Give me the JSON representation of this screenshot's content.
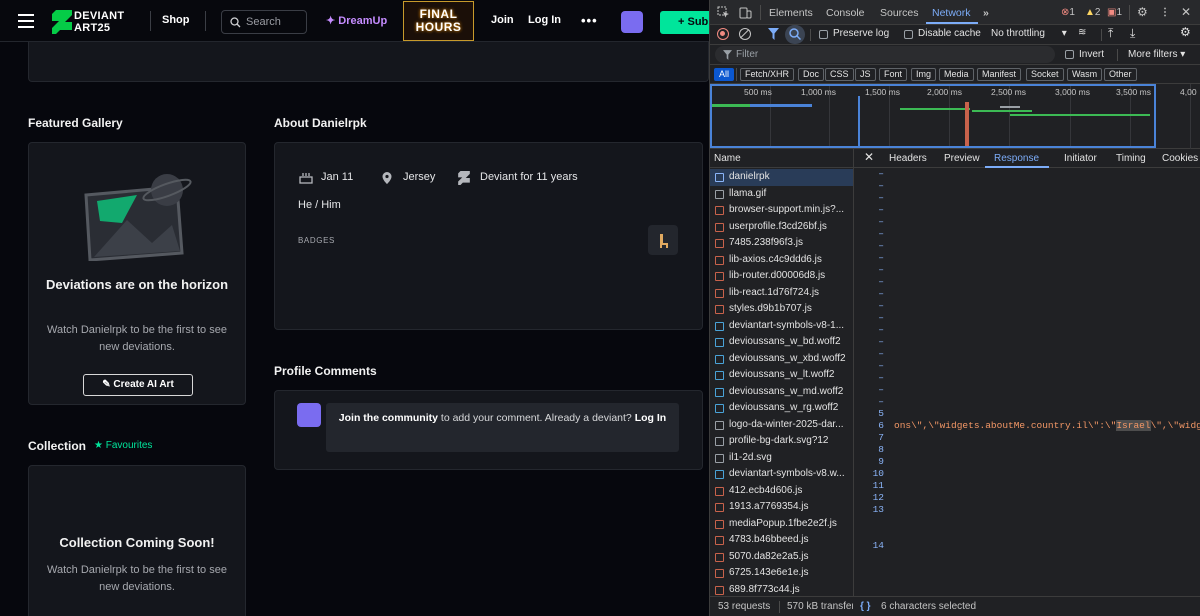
{
  "site": {
    "logo_line1": "DEVIANT",
    "logo_line2": "ART25",
    "nav": {
      "shop": "Shop",
      "search_placeholder": "Search",
      "dreamup": "DreamUp",
      "banner_line1": "FINAL",
      "banner_line2": "HOURS",
      "join": "Join",
      "login": "Log In",
      "more": "•••",
      "submit": "Sub"
    },
    "featured_gallery": {
      "title": "Featured Gallery",
      "empty_title": "Deviations are on the horizon",
      "empty_sub": "Watch Danielrpk to be the first to see new deviations.",
      "button": "Create AI Art"
    },
    "about": {
      "title": "About Danielrpk",
      "birthday": "Jan 11",
      "location": "Jersey",
      "deviant_for": "Deviant for 11 years",
      "pronouns": "He / Him",
      "badges_label": "BADGES"
    },
    "collection": {
      "title": "Collection",
      "favourites": "Favourites",
      "empty_title": "Collection Coming Soon!",
      "empty_sub": "Watch Danielrpk to be the first to see new deviations."
    },
    "comments": {
      "title": "Profile Comments",
      "join_link": "Join the community",
      "text": " to add your comment. Already a deviant? ",
      "login_link": "Log In"
    },
    "accent_color": "#00e59b"
  },
  "devtools": {
    "tabs": [
      "Elements",
      "Console",
      "Sources",
      "Network"
    ],
    "active_tab": "Network",
    "counts": {
      "errors": "1",
      "warnings": "2",
      "issues": "1"
    },
    "toolbar": {
      "preserve_log": "Preserve log",
      "disable_cache": "Disable cache",
      "throttling": "No throttling"
    },
    "filter": {
      "placeholder": "Filter",
      "invert": "Invert",
      "more_filters": "More filters"
    },
    "types": [
      "All",
      "Fetch/XHR",
      "Doc",
      "CSS",
      "JS",
      "Font",
      "Img",
      "Media",
      "Manifest",
      "Socket",
      "Wasm",
      "Other"
    ],
    "timeline_labels": [
      "500 ms",
      "1,000 ms",
      "1,500 ms",
      "2,000 ms",
      "2,500 ms",
      "3,000 ms",
      "3,500 ms",
      "4,00"
    ],
    "list_header": "Name",
    "requests": [
      {
        "name": "danielrpk",
        "kind": "doc"
      },
      {
        "name": "llama.gif",
        "kind": "img"
      },
      {
        "name": "browser-support.min.js?...",
        "kind": "js"
      },
      {
        "name": "userprofile.f3cd26bf.js",
        "kind": "js"
      },
      {
        "name": "7485.238f96f3.js",
        "kind": "js"
      },
      {
        "name": "lib-axios.c4c9ddd6.js",
        "kind": "js"
      },
      {
        "name": "lib-router.d00006d8.js",
        "kind": "js"
      },
      {
        "name": "lib-react.1d76f724.js",
        "kind": "js"
      },
      {
        "name": "styles.d9b1b707.js",
        "kind": "js"
      },
      {
        "name": "deviantart-symbols-v8-1...",
        "kind": "font"
      },
      {
        "name": "devioussans_w_bd.woff2",
        "kind": "font"
      },
      {
        "name": "devioussans_w_xbd.woff2",
        "kind": "font"
      },
      {
        "name": "devioussans_w_lt.woff2",
        "kind": "font"
      },
      {
        "name": "devioussans_w_md.woff2",
        "kind": "font"
      },
      {
        "name": "devioussans_w_rg.woff2",
        "kind": "font"
      },
      {
        "name": "logo-da-winter-2025-dar...",
        "kind": "img"
      },
      {
        "name": "profile-bg-dark.svg?12",
        "kind": "img"
      },
      {
        "name": "il1-2d.svg",
        "kind": "img"
      },
      {
        "name": "deviantart-symbols-v8.w...",
        "kind": "font"
      },
      {
        "name": "412.ecb4d606.js",
        "kind": "js"
      },
      {
        "name": "1913.a7769354.js",
        "kind": "js"
      },
      {
        "name": "mediaPopup.1fbe2e2f.js",
        "kind": "js"
      },
      {
        "name": "4783.b46bbeed.js",
        "kind": "js"
      },
      {
        "name": "5070.da82e2a5.js",
        "kind": "js"
      },
      {
        "name": "6725.143e6e1e.js",
        "kind": "js"
      },
      {
        "name": "689.8f773c44.js",
        "kind": "js"
      }
    ],
    "detail_tabs": [
      "Headers",
      "Preview",
      "Response",
      "Initiator",
      "Timing",
      "Cookies"
    ],
    "active_detail_tab": "Response",
    "line_numbers": [
      "5",
      "6",
      "7",
      "8",
      "9",
      "10",
      "11",
      "12",
      "13",
      "14"
    ],
    "code_line_6_pre": "ons\\\",\\\"widgets.aboutMe.country.il\\\":\\\"",
    "code_line_6_hl": "Israel",
    "code_line_6_post": "\\\",\\\"widgets.a",
    "status": {
      "requests": "53 requests",
      "transferred": "570 kB transfer",
      "selection": "6 characters selected"
    }
  }
}
